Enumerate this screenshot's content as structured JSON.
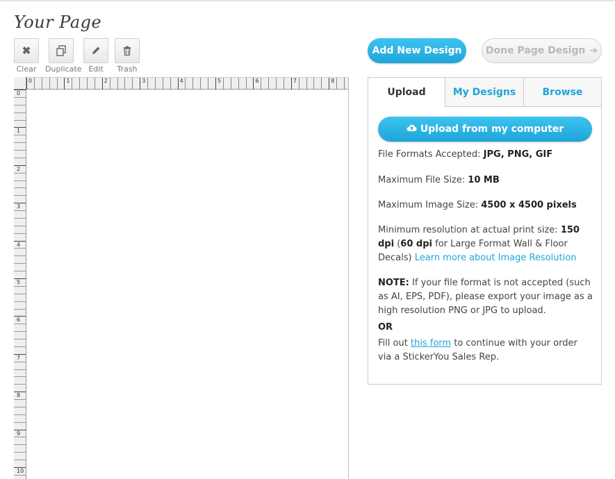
{
  "page": {
    "title": "Your Page"
  },
  "toolbar": {
    "clear": {
      "label": "Clear",
      "icon": "close-icon"
    },
    "duplicate": {
      "label": "Duplicate",
      "icon": "duplicate-icon"
    },
    "edit": {
      "label": "Edit",
      "icon": "pencil-icon"
    },
    "trash": {
      "label": "Trash",
      "icon": "trash-icon"
    }
  },
  "ruler": {
    "top_numbers": [
      "0",
      "1",
      "2",
      "3",
      "4",
      "5",
      "6",
      "7",
      "8"
    ],
    "left_numbers": [
      "0",
      "1",
      "2",
      "3",
      "4",
      "5",
      "6",
      "7",
      "8",
      "9",
      "10"
    ]
  },
  "actions": {
    "add_new_design": "Add New Design",
    "done_page_design": "Done Page Design",
    "done_arrow": "➔"
  },
  "tabs": [
    {
      "label": "Upload"
    },
    {
      "label": "My Designs"
    },
    {
      "label": "Browse"
    }
  ],
  "upload": {
    "button_label": "Upload from my computer",
    "formats_label": "File Formats Accepted: ",
    "formats_value": "JPG, PNG, GIF",
    "max_size_label": "Maximum File Size: ",
    "max_size_value": "10 MB",
    "max_image_label": "Maximum Image Size: ",
    "max_image_value": "4500 x 4500 pixels",
    "min_res_label": "Minimum resolution at actual print size: ",
    "min_res_value": "150 dpi",
    "min_res_paren_open": " (",
    "min_res_large": "60 dpi",
    "min_res_rest": " for Large Format Wall & Floor Decals) ",
    "learn_more": "Learn more about Image Resolution",
    "note_label": "NOTE:",
    "note_text": " If your file format is not accepted (such as AI, EPS, PDF), please export your image as a high resolution PNG or JPG to upload.",
    "or_label": "OR",
    "fill_out": "Fill out ",
    "this_form": "this form",
    "fill_rest": " to continue with your order via a StickerYou Sales Rep."
  },
  "colors": {
    "accent": "#1ea5d8",
    "button_gradient_top": "#3cc3f0"
  }
}
